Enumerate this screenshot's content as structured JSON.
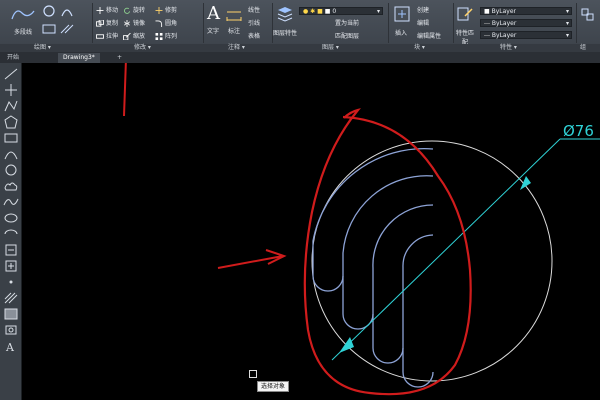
{
  "ribbon": {
    "draw": {
      "polyline_label": "多段线",
      "panel_label": "绘图 ▾"
    },
    "modify": {
      "move_label": "移动",
      "rotate_label": "旋转",
      "trim_label": "修剪",
      "copy_label": "复制",
      "mirror_label": "镜像",
      "fillet_label": "圆角",
      "stretch_label": "拉伸",
      "scale_label": "缩放",
      "array_label": "阵列",
      "panel_label": "修改 ▾"
    },
    "annotation": {
      "text_label": "文字",
      "dimension_label": "标注",
      "linear_label": "线性",
      "leader_label": "引线",
      "table_label": "表格",
      "panel_label": "注释 ▾"
    },
    "layers": {
      "layer_properties_label": "图层特性",
      "current_layer": "0",
      "make_current_label": "置为当前",
      "match_layer_label": "匹配图层",
      "panel_label": "图层 ▾"
    },
    "block": {
      "insert_label": "插入",
      "create_label": "创建",
      "edit_label": "编辑",
      "edit_attributes_label": "编辑属性",
      "panel_label": "块 ▾"
    },
    "properties": {
      "match_properties_label": "特性匹配",
      "color_value": "ByLayer",
      "linetype_value": "ByLayer",
      "lineweight_value": "ByLayer",
      "panel_label": "特性 ▾"
    },
    "groups": {
      "panel_label": "组"
    }
  },
  "tabs": [
    {
      "label": "开始"
    },
    {
      "label": "Drawing3*"
    },
    {
      "label": "+"
    }
  ],
  "drawing": {
    "dimension_text": "Ø76",
    "colors": {
      "circle": "#dcdcdc",
      "arcs": "#8da3d6",
      "dimension": "#2fd2d6",
      "annotation": "#d01c1c"
    }
  },
  "cursor_tooltip": "选择对象"
}
